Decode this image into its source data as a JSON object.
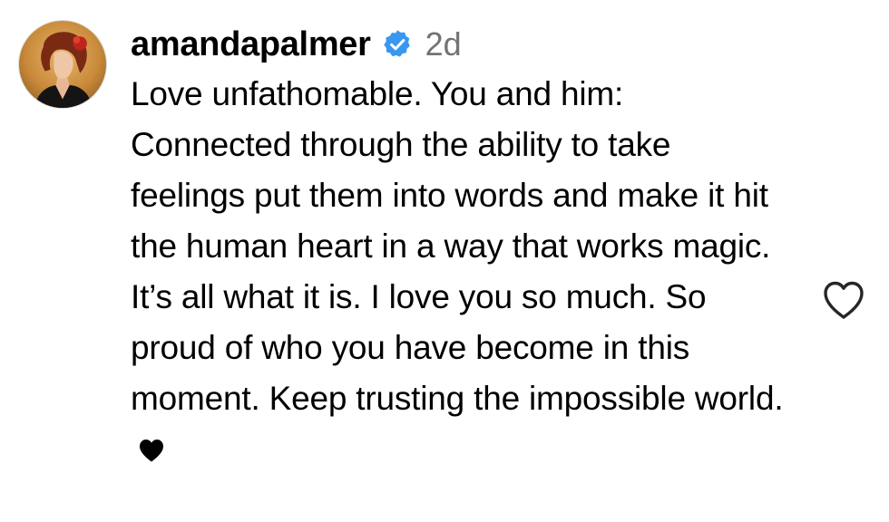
{
  "comment": {
    "username": "amandapalmer",
    "verified_icon": "verified-badge-icon",
    "time_ago": "2d",
    "text": "Love unfathomable. You and him: Connected through the ability to take feelings put them into words and make it hit the human heart in a way that works magic. It’s all what it is. I love you so much. So proud of who you have become in this moment. Keep trusting the impossible world.",
    "trailing_emoji_icon": "black-heart-icon",
    "like_icon": "heart-outline-icon"
  },
  "colors": {
    "verified_blue": "#3897f0",
    "muted_text": "#737373",
    "text": "#000000"
  }
}
